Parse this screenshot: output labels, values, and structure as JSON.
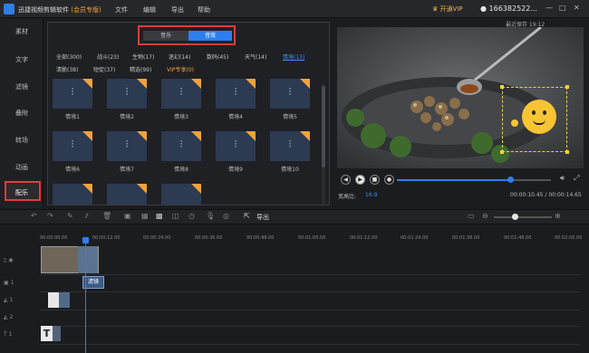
{
  "app": {
    "title": "迅捷视频剪辑软件",
    "vip_tag": "(会员专版)",
    "menus": [
      "文件",
      "编辑",
      "导出",
      "帮助"
    ],
    "vip_button": "开通VIP",
    "user": "166382522...",
    "autosave": "最近保存 19:12"
  },
  "sidebar": {
    "items": [
      "素材",
      "文字",
      "滤镜",
      "叠附",
      "转场",
      "动画",
      "配乐"
    ],
    "selected": "配乐"
  },
  "library": {
    "tabs": {
      "music": "音乐",
      "sfx": "音效"
    },
    "active_tab": "音效",
    "categories": [
      "全部(300)",
      "战斗(23)",
      "生物(17)",
      "迷幻(14)",
      "数码(45)",
      "天气(14)",
      "情境(13)",
      "清脆(38)",
      "短促(37)",
      "精选(99)",
      "VIP专享(0)"
    ],
    "active_category": "情境(13)",
    "tiles": [
      "情境1",
      "情境2",
      "情境3",
      "情境4",
      "情境5",
      "情境6",
      "情境7",
      "情境8",
      "情境9",
      "情境10",
      "",
      ""
    ]
  },
  "preview": {
    "aspect_label": "宽高比:",
    "aspect_value": "16:9",
    "timecode": "00:00:10.45 / 00:00:14.65",
    "progress": 0.71
  },
  "toolbar": {
    "export": "导出"
  },
  "timeline": {
    "ruler": [
      "00:00:00.00",
      "00:00:12.00",
      "00:00:24.00",
      "00:00:36.00",
      "00:00:48.00",
      "00:01:00.00",
      "00:01:12.00",
      "00:01:24.00",
      "00:01:36.00",
      "00:01:48.00",
      "00:02:00.00"
    ],
    "track_labels": [
      "",
      "1",
      "1",
      "2",
      "1"
    ],
    "fx_clip": "滤镜",
    "text_clip": "T"
  },
  "colors": {
    "accent": "#2e7ef0",
    "highlight": "#e23b3b",
    "vip": "#f0a23c"
  }
}
